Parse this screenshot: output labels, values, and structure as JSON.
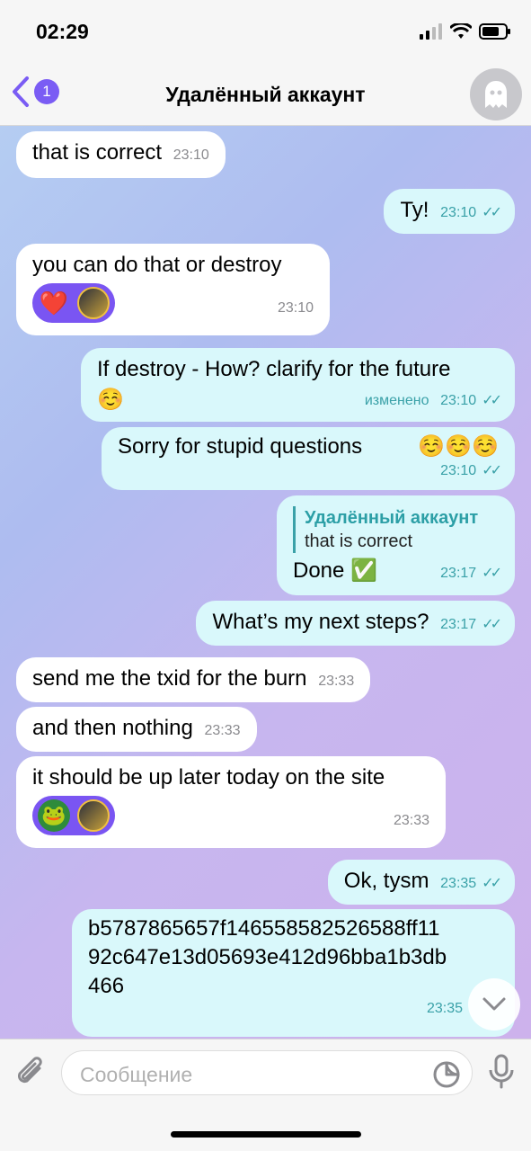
{
  "status": {
    "time": "02:29"
  },
  "nav": {
    "back_count": "1",
    "title": "Удалённый аккаунт"
  },
  "messages": [
    {
      "text": "that is correct",
      "time": "23:10"
    },
    {
      "text": "Ty!",
      "time": "23:10"
    },
    {
      "text": "you can do that or destroy",
      "time": "23:10"
    },
    {
      "text": "If destroy - How? clarify for the future",
      "emoji": "☺️",
      "edited": "изменено",
      "time": "23:10"
    },
    {
      "text": "Sorry for stupid questions",
      "emoji": "☺️☺️☺️",
      "time": "23:10"
    },
    {
      "reply_name": "Удалённый аккаунт",
      "reply_text": "that is correct",
      "text": "Done",
      "emoji": "✅",
      "time": "23:17"
    },
    {
      "text": "What’s my next steps?",
      "time": "23:17"
    },
    {
      "text": "send me the txid for the burn",
      "time": "23:33"
    },
    {
      "text": "and then nothing",
      "time": "23:33"
    },
    {
      "text": "it should be up later today on the site",
      "time": "23:33"
    },
    {
      "text": "Ok, tysm",
      "time": "23:35"
    },
    {
      "text_lines": [
        "b5787865657f146558582526588ff11",
        "92c647e13d05693e412d96bba1b3db",
        "466"
      ],
      "time": "23:35"
    }
  ],
  "input": {
    "placeholder": "Сообщение"
  },
  "colors": {
    "accent": "#7a55f2",
    "outgoing_bubble": "#d9f8fb",
    "incoming_bubble": "#ffffff",
    "reply_accent": "#2c9fa6"
  }
}
